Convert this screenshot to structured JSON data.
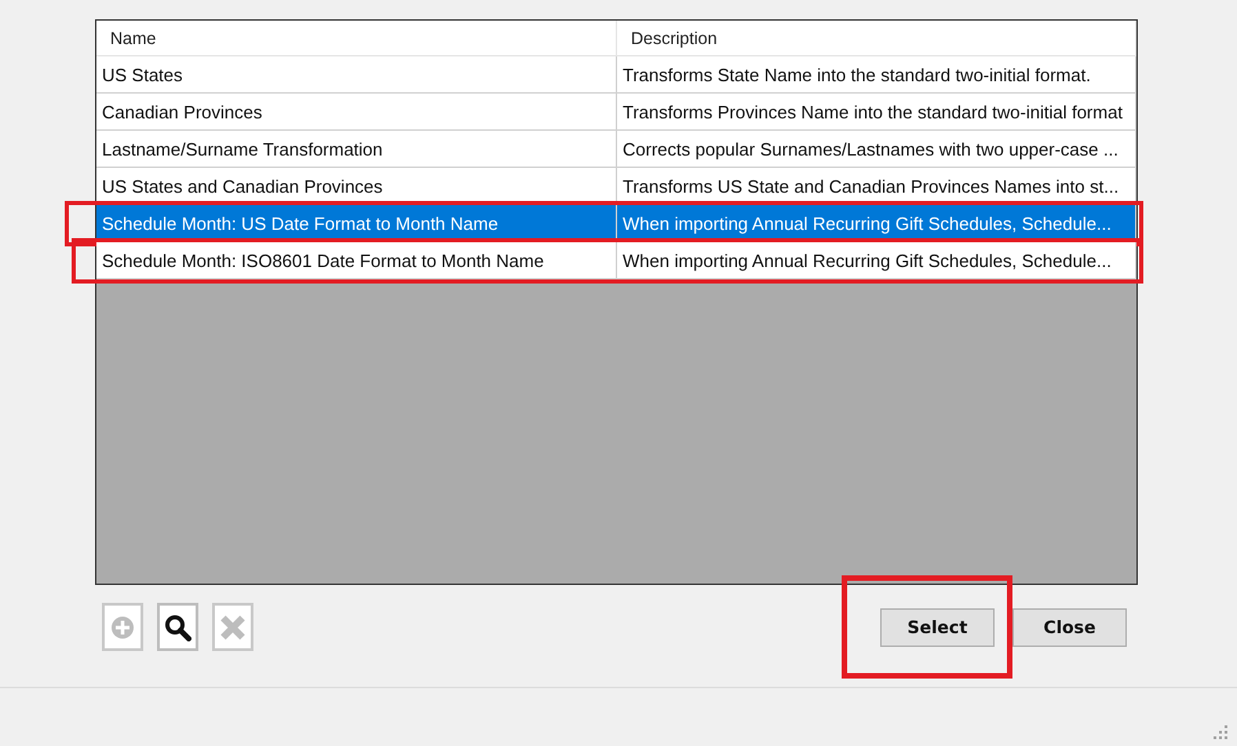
{
  "table": {
    "columns": [
      "Name",
      "Description"
    ],
    "rows": [
      {
        "name": "US States",
        "description": "Transforms State Name into the standard two-initial format.",
        "selected": false,
        "highlighted": false
      },
      {
        "name": "Canadian Provinces",
        "description": "Transforms Provinces Name into the standard two-initial format",
        "selected": false,
        "highlighted": false
      },
      {
        "name": "Lastname/Surname Transformation",
        "description": "Corrects popular Surnames/Lastnames with two upper-case ...",
        "selected": false,
        "highlighted": false
      },
      {
        "name": "US States and Canadian Provinces",
        "description": "Transforms US State and Canadian Provinces Names into st...",
        "selected": false,
        "highlighted": false
      },
      {
        "name": "Schedule Month: US Date Format to Month Name",
        "description": "When importing Annual Recurring Gift Schedules, Schedule...",
        "selected": true,
        "highlighted": true
      },
      {
        "name": "Schedule Month: ISO8601 Date Format to Month Name",
        "description": "When importing Annual Recurring Gift Schedules, Schedule...",
        "selected": false,
        "highlighted": true
      }
    ]
  },
  "toolbar": [
    {
      "kind": "add",
      "disabled": true
    },
    {
      "kind": "search",
      "disabled": false
    },
    {
      "kind": "delete",
      "disabled": true
    }
  ],
  "buttons": [
    {
      "label": "Select",
      "highlighted": true
    },
    {
      "label": "Close",
      "highlighted": false
    }
  ]
}
